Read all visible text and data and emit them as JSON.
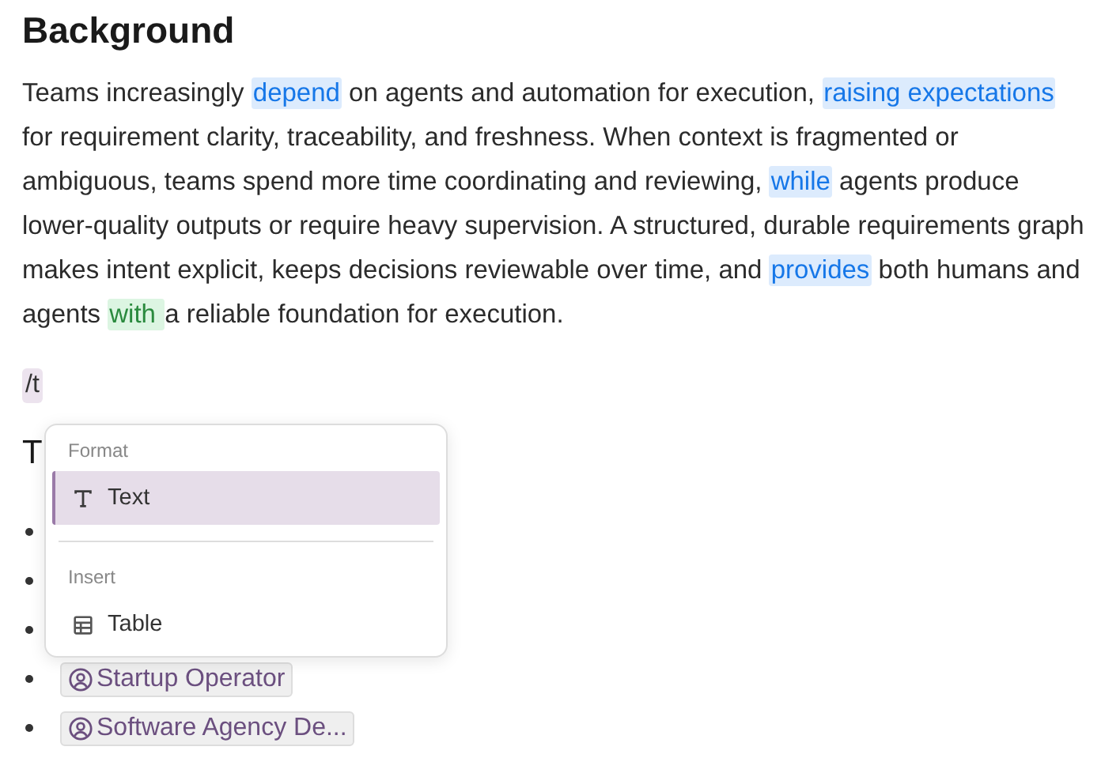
{
  "heading": "Background",
  "paragraph": [
    {
      "text": "Teams increasingly ",
      "kind": "plain"
    },
    {
      "text": "depend",
      "kind": "link"
    },
    {
      "text": " on agents and automation for execution, ",
      "kind": "plain"
    },
    {
      "text": "raising expectations ",
      "kind": "link"
    },
    {
      "text": "for requirement clarity, traceability, and freshness. When context is fragmented or ambiguous, teams spend more time coordinating and reviewing, ",
      "kind": "plain"
    },
    {
      "text": "while",
      "kind": "link"
    },
    {
      "text": " agents produce lower-quality outputs or require heavy supervision. A structured, durable requirements graph makes intent explicit, keeps decisions reviewable over time, and ",
      "kind": "plain"
    },
    {
      "text": "provides",
      "kind": "link"
    },
    {
      "text": " both humans and agents ",
      "kind": "plain"
    },
    {
      "text": "with ",
      "kind": "match"
    },
    {
      "text": "a reliable foundation for execution.",
      "kind": "plain"
    }
  ],
  "command": "/t",
  "second_heading": "T",
  "list_items": [
    {
      "kind": "covered"
    },
    {
      "kind": "covered"
    },
    {
      "kind": "covered"
    },
    {
      "kind": "person",
      "label": "Startup Operator"
    },
    {
      "kind": "person",
      "label": "Software Agency De..."
    }
  ],
  "menu": {
    "sections": [
      {
        "title": "Format",
        "items": [
          {
            "label": "Text",
            "kind": "text",
            "selected": true
          }
        ]
      },
      {
        "title": "Insert",
        "items": [
          {
            "label": "Table",
            "kind": "table",
            "selected": false
          }
        ]
      }
    ]
  }
}
